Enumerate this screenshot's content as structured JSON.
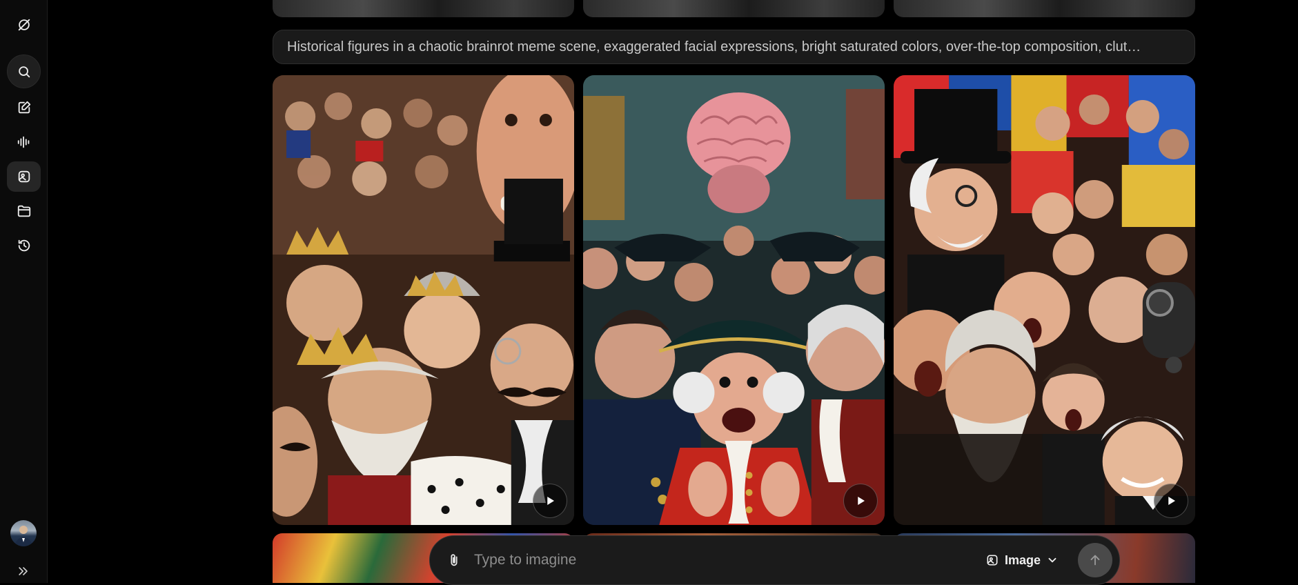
{
  "sidebar": {
    "items": [
      {
        "icon": "grok-logo-icon"
      },
      {
        "icon": "search-icon"
      },
      {
        "icon": "edit-icon"
      },
      {
        "icon": "voice-waveform-icon"
      },
      {
        "icon": "imagine-icon",
        "active": true
      },
      {
        "icon": "folder-icon"
      },
      {
        "icon": "history-icon"
      }
    ],
    "avatar": {
      "icon": "user-avatar"
    },
    "expand": {
      "icon": "double-chevron-right-icon"
    }
  },
  "feed": {
    "prompt_text": "Historical figures in a chaotic brainrot meme scene, exaggerated facial expressions, bright saturated colors, over-the-top composition, clut…",
    "cards": [
      {
        "play_icon": "play-icon",
        "theme": "royal crowds with crowns and top hat"
      },
      {
        "play_icon": "play-icon",
        "theme": "tricorn hat figures with giant brain"
      },
      {
        "play_icon": "play-icon",
        "theme": "bearded figures and gas mask collage"
      }
    ]
  },
  "composer": {
    "placeholder": "Type to imagine",
    "mode_label": "Image",
    "attach_icon": "paperclip-icon",
    "mode_icon": "image-icon",
    "send_icon": "arrow-up-icon"
  },
  "colors": {
    "background": "#000000",
    "sidebar": "#0b0b0b",
    "surface": "#1b1b1b",
    "send_button": "#4a4a4a"
  }
}
